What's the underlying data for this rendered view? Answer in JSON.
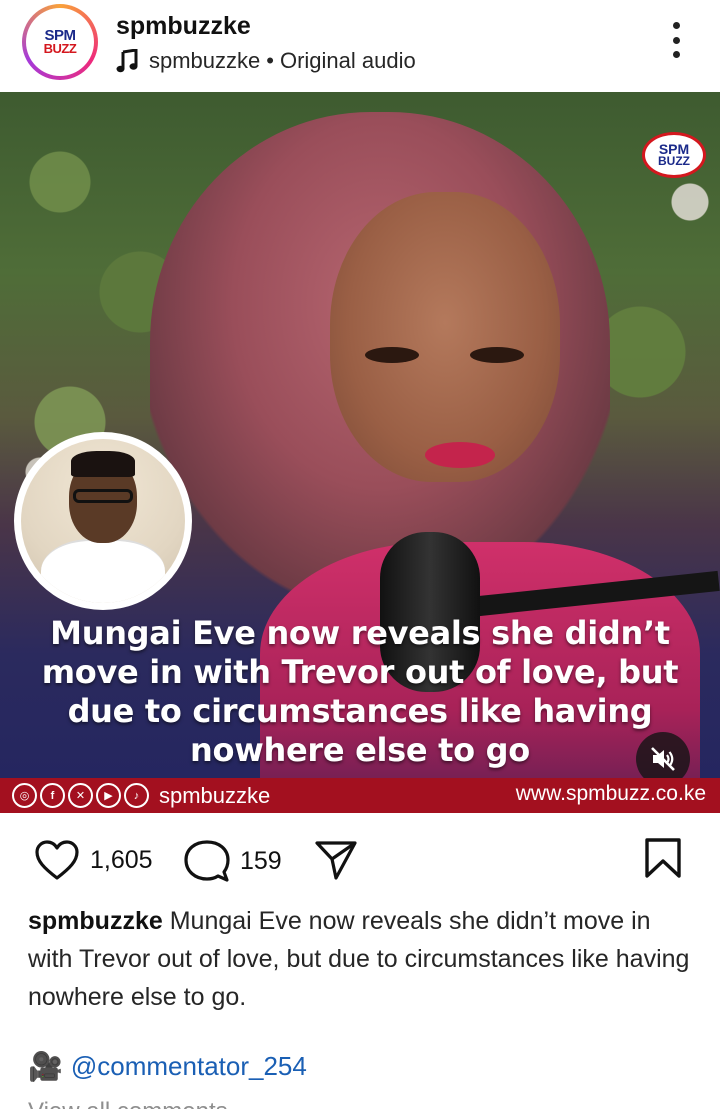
{
  "post": {
    "username": "spmbuzzke",
    "audio": {
      "artist": "spmbuzzke",
      "separator": "•",
      "label": "Original audio"
    },
    "avatar_logo": {
      "line1": "SPM",
      "line2": "BUZZ"
    }
  },
  "media": {
    "watermark": {
      "line1": "SPM",
      "line2": "BUZZ"
    },
    "headline": "Mungai Eve now reveals she didn’t move in with Trevor out of love, but due to circumstances like having nowhere else to go",
    "footer": {
      "social_icons": [
        "instagram-icon",
        "facebook-icon",
        "x-icon",
        "youtube-icon",
        "tiktok-icon"
      ],
      "social_glyphs": [
        "◎",
        "f",
        "✕",
        "▶",
        "♪"
      ],
      "handle": "spmbuzzke",
      "url": "www.spmbuzz.co.ke"
    },
    "muted": true
  },
  "actions": {
    "likes": "1,605",
    "comments": "159"
  },
  "caption": {
    "username": "spmbuzzke",
    "text": "Mungai Eve now reveals she didn’t move in with Trevor out of love, but due to circumstances like having nowhere else to go."
  },
  "credit": {
    "icon": "🎥",
    "mention": "@commentator_254"
  },
  "view_all_comments": "View all comments",
  "colors": {
    "footer_bar": "#a3101f",
    "link": "#1a5fb4",
    "brand_blue": "#1b2a8a",
    "brand_red": "#d4171e"
  }
}
